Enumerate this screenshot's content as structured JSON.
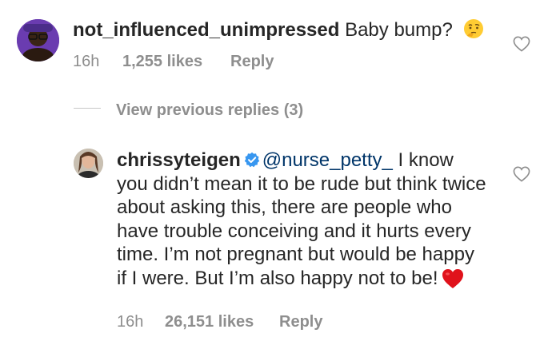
{
  "comment1": {
    "username": "not_influenced_unimpressed",
    "text": "Baby bump?",
    "emoji": "thinking-face-emoji",
    "time": "16h",
    "likes": "1,255 likes",
    "reply_label": "Reply"
  },
  "view_previous": {
    "label": "View previous replies (3)"
  },
  "comment2": {
    "username": "chrissyteigen",
    "verified": true,
    "mention": "@nurse_petty_",
    "text": " I know you didn’t mean it to be rude but think twice about asking this, there are people who have trouble conceiving and it hurts every time. I’m not pregnant but would be happy if I were. But I’m also happy not to be!",
    "emoji": "red-heart-emoji",
    "time": "16h",
    "likes": "26,151 likes",
    "reply_label": "Reply"
  },
  "colors": {
    "text": "#262626",
    "meta": "#8e8e8e",
    "mention": "#003569",
    "verified": "#3897f0",
    "heart": "#e0121b"
  },
  "icons": [
    "thinking-face-emoji",
    "verified-badge-icon",
    "red-heart-emoji",
    "like-heart-icon"
  ]
}
